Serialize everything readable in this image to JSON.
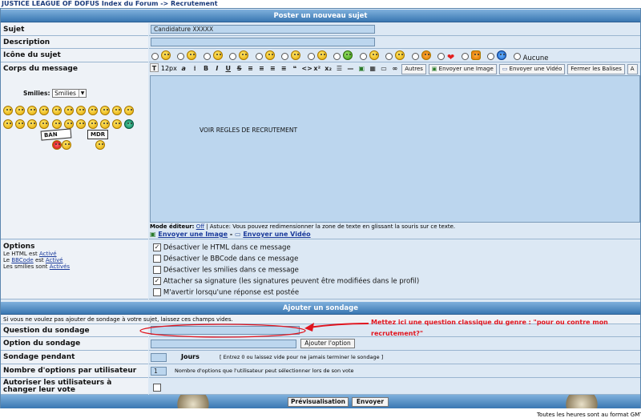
{
  "breadcrumb": {
    "forum": "JUSTICE LEAGUE OF DOFUS",
    "sep1": " Index du Forum -> ",
    "current": "Recrutement"
  },
  "post": {
    "header": "Poster un nouveau sujet",
    "subject_label": "Sujet",
    "subject_value": "Candidature XXXXX",
    "description_label": "Description",
    "icon_label": "Icône du sujet",
    "icon_none": "Aucune",
    "body_label": "Corps du message",
    "smilies_label": "Smilies:",
    "smilies_select": "Smilies",
    "signs": [
      "BAN",
      "MDR"
    ],
    "body_text": "VOIR REGLES DE RECRUTEMENT",
    "toolbar": {
      "size": "12px",
      "bold": "B",
      "italic": "I",
      "underline": "U",
      "strike": "S",
      "quote": "❝",
      "code": "<>",
      "autres": "Autres",
      "send_image": "Envoyer une Image",
      "send_video": "Envoyer une Vidéo",
      "close_tags": "Fermer les Balises",
      "more": "A"
    },
    "editor_mode_label": "Mode éditeur:",
    "editor_mode_value": "Off",
    "editor_hint": " | Astuce: Vous pouvez redimensionner la zone de texte en glissant la souris sur ce texte.",
    "link_image": "Envoyer une Image",
    "link_dash": " - ",
    "link_video": "Envoyer une Vidéo"
  },
  "options": {
    "label": "Options",
    "html_pre": "Le HTML est ",
    "html_state": "Activé",
    "bbcode_pre": "Le ",
    "bbcode_link": "BBCode",
    "bbcode_mid": " est ",
    "bbcode_state": "Activé",
    "smilies_pre": "Les smilies sont ",
    "smilies_state": "Activés",
    "items": [
      {
        "label": "Désactiver le HTML dans ce message",
        "checked": true
      },
      {
        "label": "Désactiver le BBCode dans ce message",
        "checked": false
      },
      {
        "label": "Désactiver les smilies dans ce message",
        "checked": false
      },
      {
        "label": "Attacher sa signature (les signatures peuvent être modifiées dans le profil)",
        "checked": true
      },
      {
        "label": "M'avertir lorsqu'une réponse est postée",
        "checked": false
      }
    ]
  },
  "poll": {
    "header": "Ajouter un sondage",
    "hint": "Si vous ne voulez pas ajouter de sondage à votre sujet, laissez ces champs vides.",
    "question_label": "Question du sondage",
    "option_label": "Option du sondage",
    "add_option": "Ajouter l'option",
    "duration_label": "Sondage pendant",
    "days": "Jours",
    "duration_hint": "[ Entrez 0 ou laissez vide pour ne jamais terminer le sondage ]",
    "max_label": "Nombre d'options par utilisateur",
    "max_value": "1",
    "max_hint": "Nombre d'options que l'utilisateur peut sélectionner lors de son vote",
    "change_label": "Autoriser les utilisateurs à changer leur vote"
  },
  "annotation": {
    "line1": "Mettez ici une question classique du genre : \"pour ou contre mon",
    "line2": "recrutement?\"",
    "color": "#e0141e"
  },
  "footer": {
    "preview": "Prévisualisation",
    "send": "Envoyer",
    "timezone": "Toutes les heures sont au format GMT"
  }
}
